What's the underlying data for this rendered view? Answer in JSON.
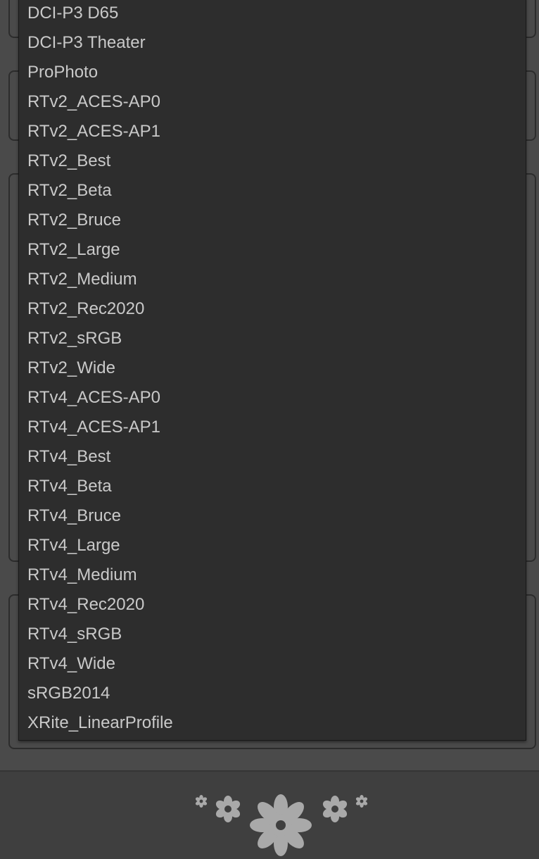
{
  "profile_menu": {
    "items": [
      "DCI-P3 D65",
      "DCI-P3 Theater",
      "ProPhoto",
      "RTv2_ACES-AP0",
      "RTv2_ACES-AP1",
      "RTv2_Best",
      "RTv2_Beta",
      "RTv2_Bruce",
      "RTv2_Large",
      "RTv2_Medium",
      "RTv2_Rec2020",
      "RTv2_sRGB",
      "RTv2_Wide",
      "RTv4_ACES-AP0",
      "RTv4_ACES-AP1",
      "RTv4_Best",
      "RTv4_Beta",
      "RTv4_Bruce",
      "RTv4_Large",
      "RTv4_Medium",
      "RTv4_Rec2020",
      "RTv4_sRGB",
      "RTv4_Wide",
      "sRGB2014",
      "XRite_LinearProfile"
    ]
  },
  "footer": {
    "ornament_icon": "floral-ornament-icon"
  },
  "colors": {
    "panel_background": "#4a4a4a",
    "menu_background": "#2d2d2d",
    "menu_text": "#c9c9c9",
    "footer_background": "#3f3f3f",
    "ornament": "#a9a9a9"
  }
}
